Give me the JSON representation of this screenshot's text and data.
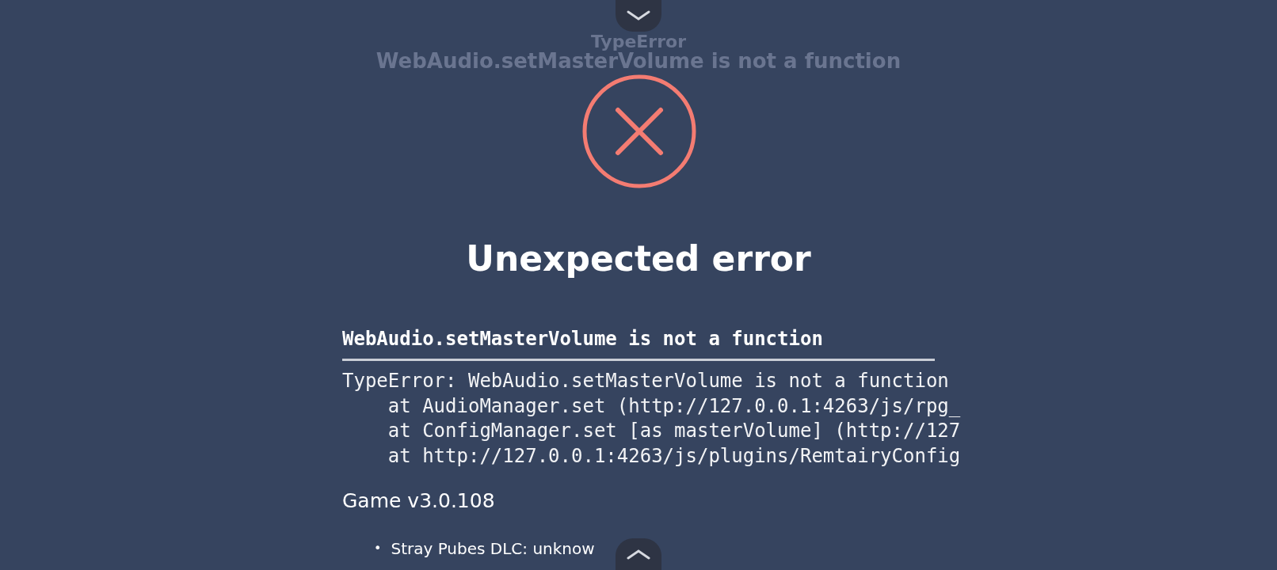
{
  "ghost_title": "TypeError",
  "ghost_message": "WebAudio.setMasterVolume is not a function",
  "title": "Unexpected error",
  "error_heading": "WebAudio.setMasterVolume is not a function",
  "stack_lines": [
    "TypeError: WebAudio.setMasterVolume is not a function",
    "    at AudioManager.set (http://127.0.0.1:4263/js/rpg_",
    "    at ConfigManager.set [as masterVolume] (http://127",
    "    at http://127.0.0.1:4263/js/plugins/RemtairyConfig"
  ],
  "version": "Game v3.0.108",
  "dlc_items": [
    {
      "bullet": "•",
      "text": "Stray Pubes DLC: unknow"
    }
  ]
}
